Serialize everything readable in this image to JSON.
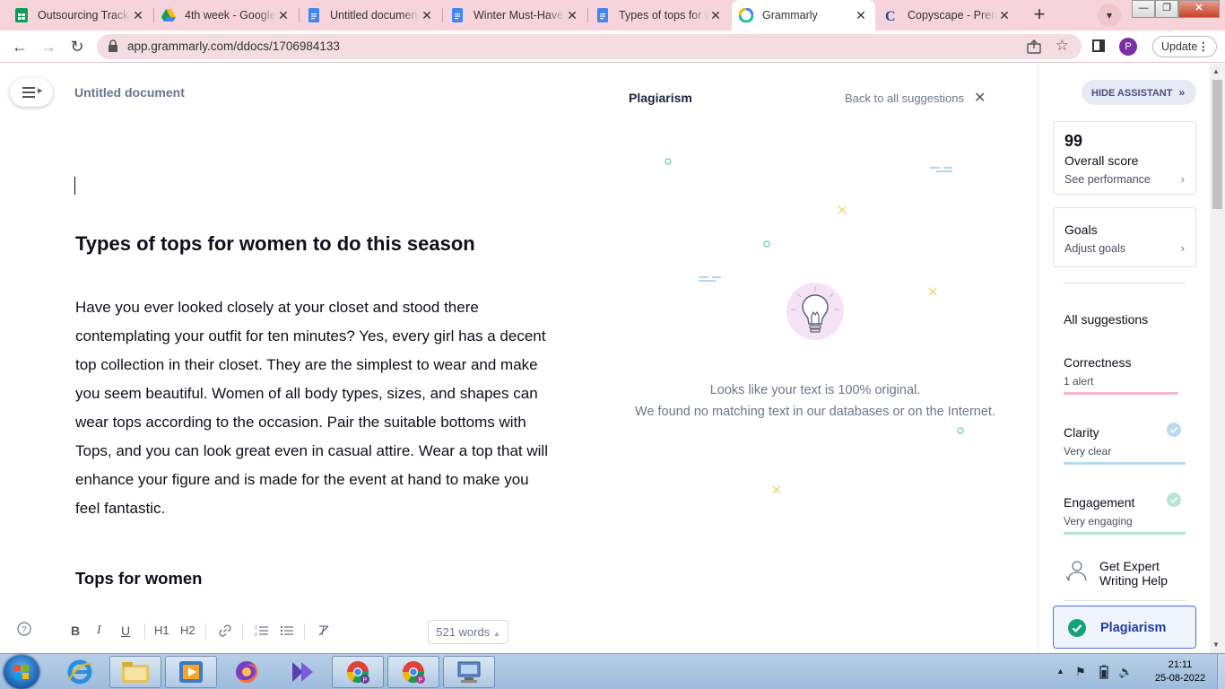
{
  "browser": {
    "tabs": [
      {
        "title": "Outsourcing Track",
        "icon": "sheets-icon",
        "color": "#0f9d58",
        "active": false
      },
      {
        "title": "4th week - Google",
        "icon": "drive-icon",
        "color": "#4285f4",
        "active": false
      },
      {
        "title": "Untitled documen",
        "icon": "docs-icon",
        "color": "#4285f4",
        "active": false
      },
      {
        "title": "Winter Must-Have",
        "icon": "docs-icon",
        "color": "#4285f4",
        "active": false
      },
      {
        "title": "Types of tops for w",
        "icon": "docs-icon",
        "color": "#4285f4",
        "active": false
      },
      {
        "title": "Grammarly",
        "icon": "grammarly-icon",
        "color": "#15c39a",
        "active": true
      },
      {
        "title": "Copyscape - Prem",
        "icon": "copyscape-icon",
        "color": "#1a4fa0",
        "active": false
      }
    ],
    "url": "app.grammarly.com/ddocs/1706984133",
    "profile_initial": "P",
    "update_label": "Update"
  },
  "editor": {
    "doc_title": "Untitled document",
    "heading": "Types of tops for women to do this season",
    "paragraph": "Have you ever looked closely at your closet and stood there contemplating your outfit for ten minutes? Yes, every girl has a decent top collection in their closet. They are the simplest to wear and make you seem beautiful. Women of all body types, sizes, and shapes can wear tops according to the occasion. Pair the suitable bottoms with Tops, and you can look great even in casual attire. Wear a top that will enhance your figure and is made for the event at hand to make you feel fantastic.",
    "subheading": "Tops for women",
    "toolbar": {
      "bold": "B",
      "italic": "I",
      "underline": "U",
      "h1": "H1",
      "h2": "H2",
      "word_count": "521 words"
    }
  },
  "plagiarism": {
    "title": "Plagiarism",
    "back_link": "Back to all suggestions",
    "result_line1": "Looks like your text is 100% original.",
    "result_line2": "We found no matching text in our databases or on the Internet."
  },
  "assistant": {
    "hide_label": "HIDE ASSISTANT",
    "overall_score": "99",
    "overall_label": "Overall score",
    "performance_link": "See performance",
    "goals_label": "Goals",
    "goals_link": "Adjust goals",
    "all_suggestions": "All suggestions",
    "categories": [
      {
        "name": "Correctness",
        "status": "1 alert",
        "color": "#f0b8c8"
      },
      {
        "name": "Clarity",
        "status": "Very clear",
        "color": "#bcd9f3"
      },
      {
        "name": "Engagement",
        "status": "Very engaging",
        "color": "#b7e6d6"
      }
    ],
    "expert_help": "Get Expert Writing Help",
    "plagiarism_label": "Plagiarism"
  },
  "taskbar": {
    "apps": [
      "internet-explorer-icon",
      "file-explorer-icon",
      "media-player-icon",
      "firefox-icon",
      "video-app-icon",
      "chrome-icon",
      "chrome-icon",
      "remote-desktop-icon"
    ],
    "time": "21:11",
    "date": "25-08-2022"
  }
}
